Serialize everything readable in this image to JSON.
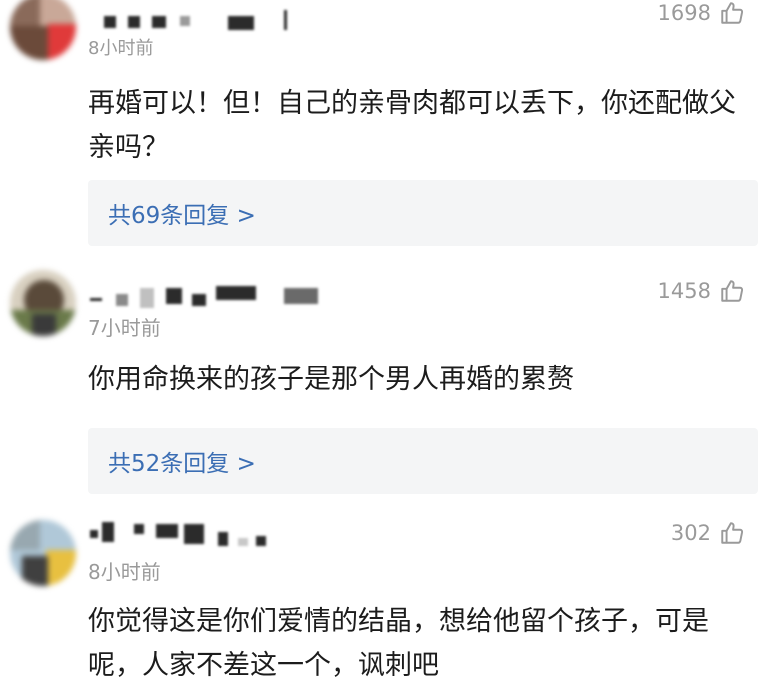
{
  "comments": [
    {
      "time": "8小时前",
      "likes": "1698",
      "text": "再婚可以！但！自己的亲骨肉都可以丢下，你还配做父亲吗？",
      "replies": "共69条回复 >",
      "avatar_colors": [
        "#8a6a5a",
        "#c9a898",
        "#e03a3a",
        "#6b4a3a"
      ]
    },
    {
      "time": "7小时前",
      "likes": "1458",
      "text": "你用命换来的孩子是那个男人再婚的累赘",
      "replies": "共52条回复 >",
      "avatar_colors": [
        "#5a4a3a",
        "#d8d0c0",
        "#6a7a4a",
        "#3a3a3a"
      ]
    },
    {
      "time": "8小时前",
      "likes": "302",
      "text": "你觉得这是你们爱情的结晶，想给他留个孩子，可是呢，人家不差这一个，讽刺吧",
      "avatar_colors": [
        "#b0c8d8",
        "#e8c040",
        "#404040",
        "#98a8b0"
      ]
    }
  ],
  "icons": {
    "like": "thumbs-up-icon"
  },
  "colors": {
    "reply_link": "#3b6eb4",
    "reply_bg": "#f4f5f6",
    "meta": "#9a9a9a"
  }
}
